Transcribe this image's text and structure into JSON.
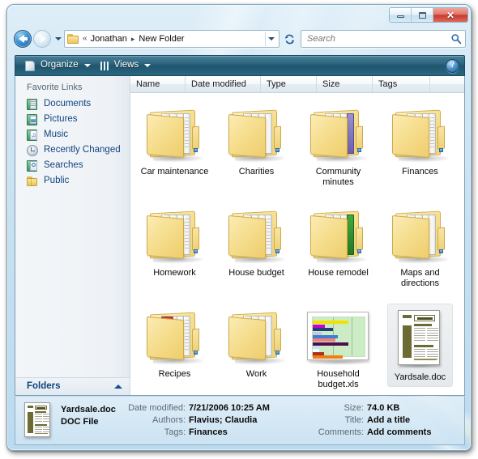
{
  "window": {
    "buttons": {
      "minimize": "minimize",
      "maximize": "maximize",
      "close": "✕"
    }
  },
  "address_bar": {
    "root_chevrons": "«",
    "crumbs": [
      "Jonathan",
      "New Folder"
    ],
    "separator": "▸",
    "folder_icon": "folder-icon"
  },
  "search": {
    "placeholder": "Search",
    "value": ""
  },
  "toolbar": {
    "organize_label": "Organize",
    "views_label": "Views",
    "help_label": "?"
  },
  "sidebar": {
    "header": "Favorite Links",
    "items": [
      {
        "label": "Documents",
        "icon": "documents-icon"
      },
      {
        "label": "Pictures",
        "icon": "pictures-icon"
      },
      {
        "label": "Music",
        "icon": "music-icon"
      },
      {
        "label": "Recently Changed",
        "icon": "recently-changed-icon"
      },
      {
        "label": "Searches",
        "icon": "searches-icon"
      },
      {
        "label": "Public",
        "icon": "public-folder-icon"
      }
    ],
    "folders_label": "Folders"
  },
  "columns": [
    {
      "label": "Name",
      "width": 68
    },
    {
      "label": "Date modified",
      "width": 93
    },
    {
      "label": "Type",
      "width": 69
    },
    {
      "label": "Size",
      "width": 69
    },
    {
      "label": "Tags",
      "width": 71
    },
    {
      "label": "",
      "width": 44
    }
  ],
  "items": [
    {
      "name": "Car maintenance",
      "kind": "folder",
      "selected": false
    },
    {
      "name": "Charities",
      "kind": "folder",
      "selected": false
    },
    {
      "name": "Community minutes",
      "kind": "folder",
      "selected": false
    },
    {
      "name": "Finances",
      "kind": "folder",
      "selected": false
    },
    {
      "name": "Homework",
      "kind": "folder",
      "selected": false
    },
    {
      "name": "House budget",
      "kind": "folder",
      "selected": false
    },
    {
      "name": "House remodel",
      "kind": "folder",
      "selected": false
    },
    {
      "name": "Maps and directions",
      "kind": "folder",
      "selected": false
    },
    {
      "name": "Recipes",
      "kind": "folder",
      "selected": false
    },
    {
      "name": "Work",
      "kind": "folder",
      "selected": false
    },
    {
      "name": "Household budget.xls",
      "kind": "spreadsheet",
      "selected": false
    },
    {
      "name": "Yardsale.doc",
      "kind": "document",
      "selected": true
    }
  ],
  "details": {
    "file_name": "Yardsale.doc",
    "file_type": "DOC File",
    "fields": [
      {
        "label": "Date modified:",
        "value": "7/21/2006 10:25 AM"
      },
      {
        "label": "Authors:",
        "value": "Flavius; Claudia"
      },
      {
        "label": "Tags:",
        "value": "Finances"
      },
      {
        "label": "Size:",
        "value": "74.0 KB"
      },
      {
        "label": "Title:",
        "value": "Add a title"
      },
      {
        "label": "Comments:",
        "value": "Add comments"
      }
    ]
  },
  "colors": {
    "frame_glass": "#cbe4f3",
    "toolbar_teal": "#2e6780",
    "link_blue": "#11437e",
    "close_red": "#c8392c",
    "folder_yellow": "#f6df91",
    "selection_gray": "#e9edf0"
  }
}
